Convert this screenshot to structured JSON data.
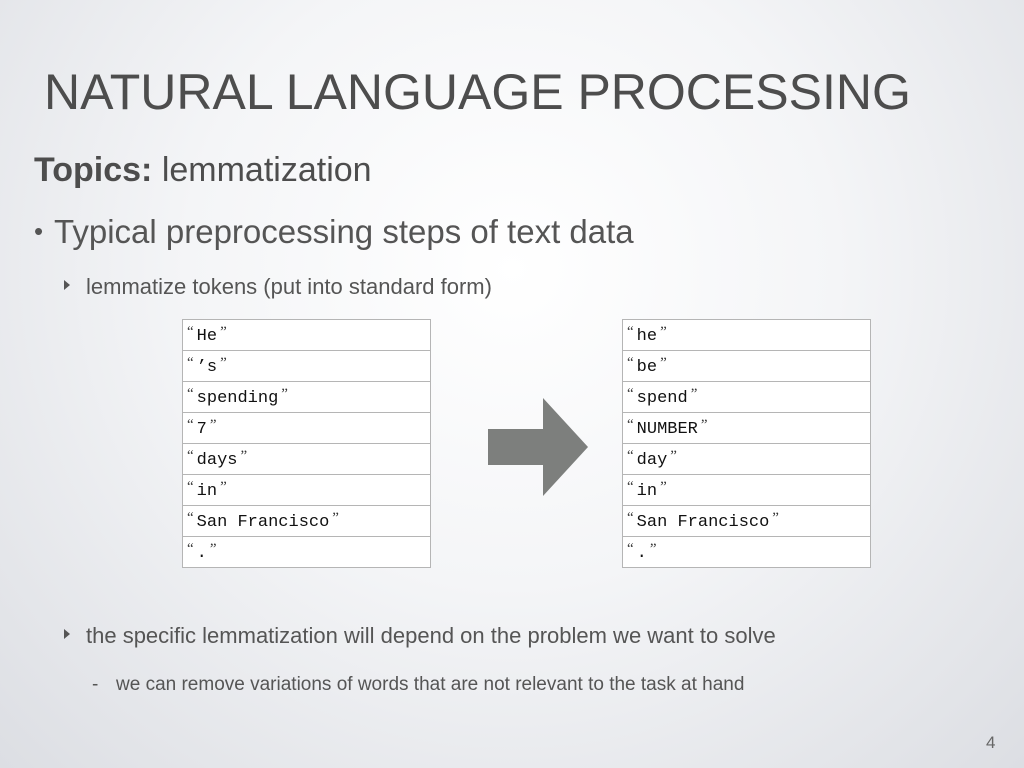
{
  "slide": {
    "title": "NATURAL LANGUAGE PROCESSING",
    "topics_label": "Topics:",
    "topics_value": " lemmatization",
    "bullet1": "Typical preprocessing steps of text data",
    "bullet1_dot": "•",
    "sub1": "lemmatize tokens (put into standard form)",
    "sub2": "the specific lemmatization will depend on the problem we want to solve",
    "subsub_dash": "-",
    "subsub": "we can remove variations of words that are not relevant to the task at hand",
    "page_number": "4"
  },
  "quotes": {
    "open": "“",
    "close": "”"
  },
  "tokens_original": [
    "He",
    "’s",
    "spending",
    "7",
    "days",
    "in",
    "San Francisco",
    "."
  ],
  "tokens_lemmatized": [
    "he",
    "be",
    "spend",
    "NUMBER",
    "day",
    "in",
    "San Francisco",
    "."
  ],
  "colors": {
    "arrow": "#7d7f7d",
    "text": "#4d4d4d"
  }
}
